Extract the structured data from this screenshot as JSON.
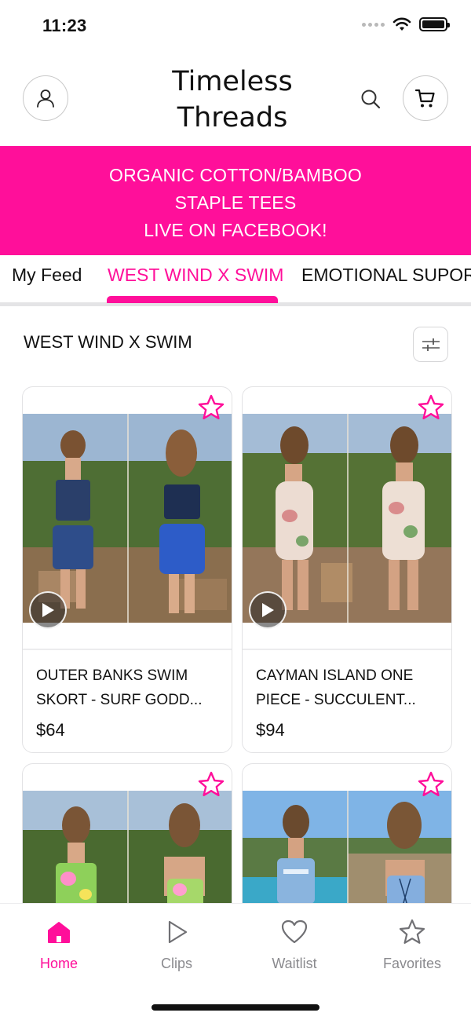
{
  "status_bar": {
    "time": "11:23"
  },
  "header": {
    "brand_line1": "Timeless",
    "brand_line2": "Threads"
  },
  "promo": {
    "line1": "ORGANIC COTTON/BAMBOO",
    "line2": "STAPLE TEES",
    "line3": "LIVE ON FACEBOOK!",
    "color": "#ff0f9a"
  },
  "tabs": [
    {
      "label": "My Feed",
      "active": false
    },
    {
      "label": "WEST WIND X SWIM",
      "active": true
    },
    {
      "label": "EMOTIONAL SUPORT",
      "active": false
    }
  ],
  "section": {
    "title": "WEST WIND X SWIM"
  },
  "products": [
    {
      "name": "OUTER BANKS SWIM SKORT - SURF GODD...",
      "price": "$64",
      "has_video": true
    },
    {
      "name": "CAYMAN ISLAND ONE PIECE - SUCCULENT...",
      "price": "$94",
      "has_video": true
    },
    {
      "name": "",
      "price": "",
      "has_video": false
    },
    {
      "name": "",
      "price": "",
      "has_video": false
    }
  ],
  "bottom_nav": [
    {
      "label": "Home",
      "icon": "home-icon",
      "active": true
    },
    {
      "label": "Clips",
      "icon": "play-icon",
      "active": false
    },
    {
      "label": "Waitlist",
      "icon": "heart-icon",
      "active": false
    },
    {
      "label": "Favorites",
      "icon": "star-icon",
      "active": false
    }
  ],
  "colors": {
    "accent": "#ff0f9a",
    "text": "#111111",
    "muted": "#8a8a8e"
  }
}
